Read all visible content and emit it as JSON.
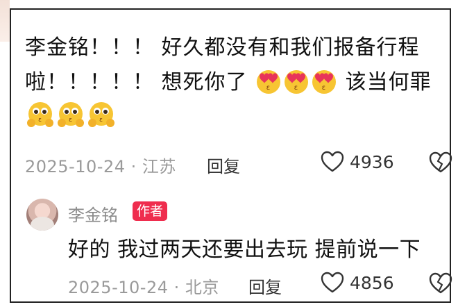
{
  "comment": {
    "text_line1": "李金铭！！！ 好久都没有和我们报备行程",
    "text_line2_before": "啦！！！！！ 想死你了",
    "text_line2_after": "该当何罪",
    "emoji_heart_eyes": "heart-eyes-kiss-emoji",
    "emoji_pleading": "pleading-hands-emoji",
    "date_location": "2025-10-24 · 江苏",
    "reply_label": "回复",
    "like_count": "4936"
  },
  "reply": {
    "author": "李金铭",
    "badge": "作者",
    "text": "好的 我过两天还要出去玩 提前说一下",
    "date_location": "2025-10-24 · 北京",
    "reply_label": "回复",
    "like_count": "4856"
  },
  "colors": {
    "badge": "#ef2d4e",
    "meta": "#9a9a9a",
    "emoji": "#f7c533",
    "heart": "#e8345a"
  }
}
